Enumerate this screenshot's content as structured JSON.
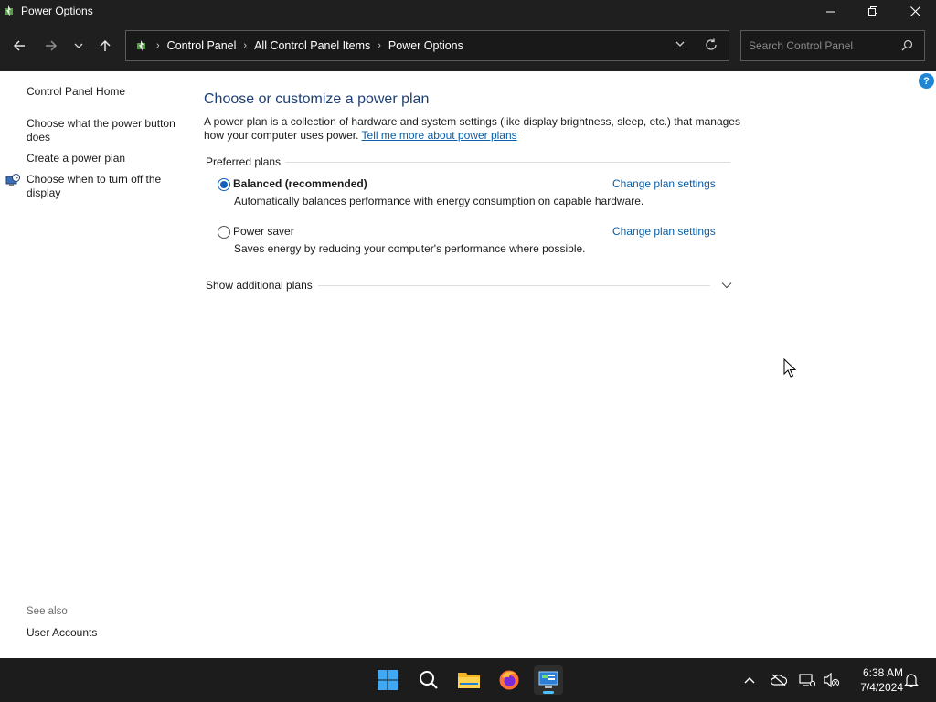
{
  "window": {
    "title": "Power Options"
  },
  "address": {
    "crumbs": [
      "Control Panel",
      "All Control Panel Items",
      "Power Options"
    ]
  },
  "search": {
    "placeholder": "Search Control Panel"
  },
  "left_pane": {
    "home": "Control Panel Home",
    "links": [
      "Choose what the power button does",
      "Create a power plan",
      "Choose when to turn off the display"
    ],
    "see_also_label": "See also",
    "see_also_links": [
      "User Accounts"
    ]
  },
  "main": {
    "title": "Choose or customize a power plan",
    "description": "A power plan is a collection of hardware and system settings (like display brightness, sleep, etc.) that manages how your computer uses power.",
    "learn_more": "Tell me more about power plans",
    "preferred_label": "Preferred plans",
    "plans": [
      {
        "name": "Balanced (recommended)",
        "description": "Automatically balances performance with energy consumption on capable hardware.",
        "change_label": "Change plan settings",
        "selected": true
      },
      {
        "name": "Power saver",
        "description": "Saves energy by reducing your computer's performance where possible.",
        "change_label": "Change plan settings",
        "selected": false
      }
    ],
    "additional_label": "Show additional plans",
    "help_label": "?"
  },
  "taskbar": {
    "time": "6:38 AM",
    "date": "7/4/2024",
    "apps": [
      "start-icon",
      "search-icon",
      "file-explorer-icon",
      "firefox-icon",
      "control-panel-icon"
    ],
    "accent": "#4cc2ff"
  }
}
